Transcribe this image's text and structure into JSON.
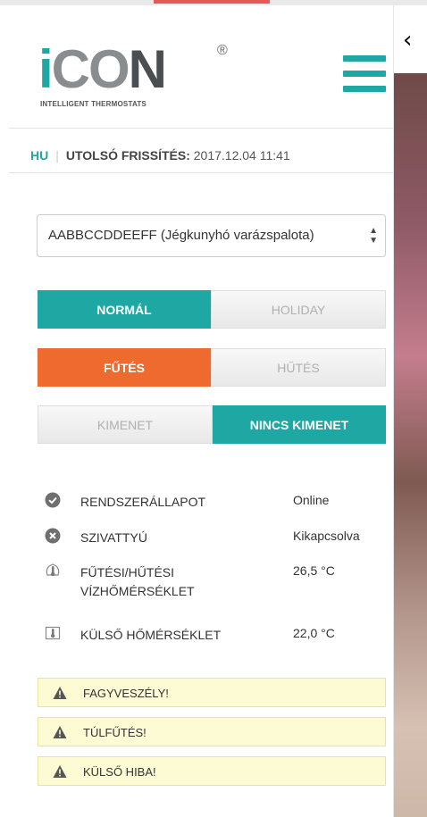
{
  "logo": {
    "letters": [
      "i",
      "CO",
      "N"
    ],
    "reg": "®",
    "tagline": "INTELLIGENT THERMOSTATS"
  },
  "header": {
    "back_icon": "chevron-left-icon",
    "menu_icon": "hamburger-menu-icon",
    "lang": "HU",
    "last_update_label": "UTOLSÓ FRISSÍTÉS:",
    "last_update_value": "2017.12.04 11:41"
  },
  "device_select": {
    "value": "AABBCCDDEEFF (Jégkunyhó varázspalota)"
  },
  "mode_toggle": {
    "options": [
      "NORMÁL",
      "HOLIDAY"
    ],
    "selected": "NORMÁL"
  },
  "heat_cool_toggle": {
    "options": [
      "FŰTÉS",
      "HŰTÉS"
    ],
    "selected": "FŰTÉS"
  },
  "output_toggle": {
    "options": [
      "KIMENET",
      "NINCS KIMENET"
    ],
    "selected": "NINCS KIMENET"
  },
  "status": [
    {
      "icon": "check-circle-icon",
      "label": "RENDSZERÁLLAPOT",
      "value": "Online"
    },
    {
      "icon": "x-circle-icon",
      "label": "SZIVATTYÚ",
      "value": "Kikapcsolva"
    },
    {
      "icon": "thermometer-icon",
      "label": "FŰTÉSI/HŰTÉSI VÍZHŐMÉRSÉKLET",
      "value": "26,5 °C"
    },
    {
      "icon": "thermometer-icon",
      "label": "KÜLSŐ HŐMÉRSÉKLET",
      "value": "22,0 °C"
    }
  ],
  "warnings": [
    {
      "icon": "warning-triangle-icon",
      "label": "FAGYVESZÉLY!"
    },
    {
      "icon": "warning-triangle-icon",
      "label": "TÚLFŰTÉS!"
    },
    {
      "icon": "warning-triangle-icon",
      "label": "KÜLSŐ HIBA!"
    }
  ],
  "colors": {
    "accent": "#1fa7a3",
    "heat": "#ef6a2e",
    "warning_bg": "#fdfbd3"
  }
}
